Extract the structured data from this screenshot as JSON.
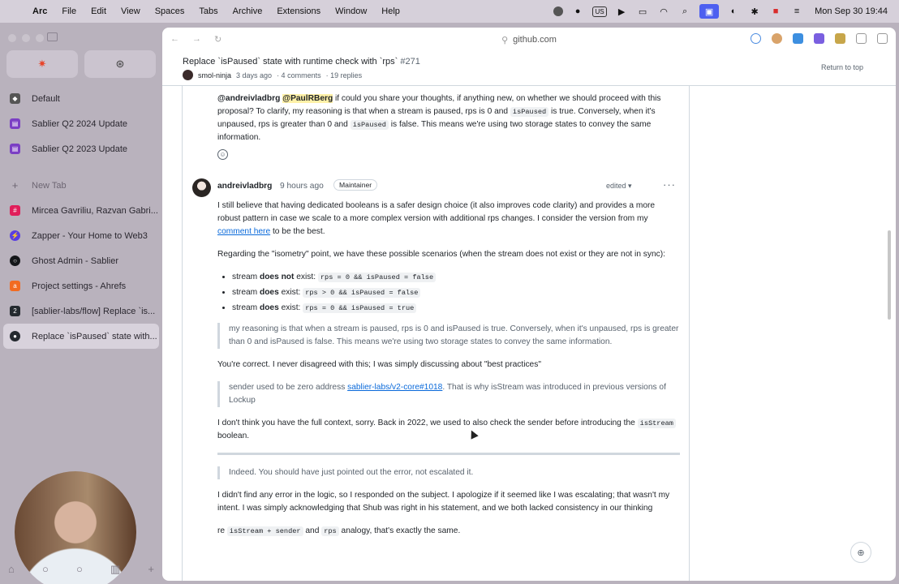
{
  "menubar": {
    "app": "Arc",
    "items": [
      "File",
      "Edit",
      "View",
      "Spaces",
      "Tabs",
      "Archive",
      "Extensions",
      "Window",
      "Help"
    ],
    "input_source": "US",
    "datetime": "Mon Sep 30  19:44"
  },
  "sidebar": {
    "items": [
      {
        "label": "Default",
        "icon": "tag-icon",
        "color": "#555555"
      },
      {
        "label": "Sablier Q2 2024 Update",
        "icon": "doc-icon",
        "color": "#7b3fc4"
      },
      {
        "label": "Sablier Q2 2023 Update",
        "icon": "doc-icon",
        "color": "#7b3fc4"
      }
    ],
    "new_tab": "New Tab",
    "tabs": [
      {
        "label": "Mircea Gavriliu, Razvan Gabri...",
        "icon": "slack-icon",
        "color": "#e01e5a"
      },
      {
        "label": "Zapper - Your Home to Web3",
        "icon": "zapper-icon",
        "color": "#5a3fe0"
      },
      {
        "label": "Ghost Admin - Sablier",
        "icon": "ghost-icon",
        "color": "#15171a"
      },
      {
        "label": "Project settings - Ahrefs",
        "icon": "ahrefs-icon",
        "color": "#f26b21"
      },
      {
        "label": "[sablier-labs/flow] Replace `is...",
        "icon": "github-icon",
        "color": "#24292f"
      },
      {
        "label": "Replace `isPaused` state with...",
        "icon": "github-icon",
        "color": "#24292f"
      }
    ]
  },
  "browser": {
    "url": "github.com"
  },
  "issue": {
    "title": "Replace `isPaused` state with runtime check with `rps`",
    "number": "#271",
    "author": "smol-ninja",
    "opened": "3 days ago",
    "comments": "· 4 comments",
    "replies": "· 19 replies",
    "return_to_top": "Return to top"
  },
  "comment1": {
    "mention1": "@andreivladbrg",
    "mention2": "@PaulRBerg",
    "t1": " if could you share your thoughts, if anything new, on whether we should proceed with this proposal? To clarify, my reasoning is that when a stream is paused, rps is 0 and ",
    "code1": "isPaused",
    "t2": " is true. Conversely, when it's unpaused, rps is greater than 0 and ",
    "code2": "isPaused",
    "t3": " is false. This means we're using two storage states to convey the same information."
  },
  "comment2": {
    "user": "andreivladbrg",
    "time": "9 hours ago",
    "badge": "Maintainer",
    "edited": "edited ▾",
    "p1a": "I still believe that having dedicated booleans is a safer design choice (it also improves code clarity) and provides a more robust pattern in case we scale to a more complex version with additional rps changes. I consider the version from my ",
    "p1link": "comment here",
    "p1b": " to be the best.",
    "p2": "Regarding the \"isometry\" point, we have these possible scenarios (when the stream does not exist or they are not in sync):",
    "bullets": [
      {
        "pre": "stream ",
        "bold": "does not",
        "post": " exist: ",
        "code": "rps = 0 && isPaused = false"
      },
      {
        "pre": "stream ",
        "bold": "does",
        "post": " exist: ",
        "code": "rps > 0 && isPaused = false"
      },
      {
        "pre": "stream ",
        "bold": "does",
        "post": " exist: ",
        "code": "rps = 0 && isPaused = true"
      }
    ],
    "quote1": "my reasoning is that when a stream is paused, rps is 0 and isPaused is true. Conversely, when it's unpaused, rps is greater than 0 and isPaused is false. This means we're using two storage states to convey the same information.",
    "p3": "You're correct. I never disagreed with this; I was simply discussing about \"best practices\"",
    "quote2a": "sender used to be zero address ",
    "quote2link": "sablier-labs/v2-core#1018",
    "quote2b": ". That is why isStream was introduced in previous versions of Lockup",
    "p4a": "I don't think you have the full context, sorry. Back in 2022, we used to also check the sender before introducing the ",
    "p4code": "isStream",
    "p4b": " boolean.",
    "quote3": "Indeed. You should have just pointed out the error, not escalated it.",
    "p5": "I didn't find any error in the logic, so I responded on the subject. I apologize if it seemed like I was escalating; that wasn't my intent. I was simply acknowledging that Shub was right in his statement, and we both lacked consistency in our thinking",
    "p6a": "re ",
    "p6code1": "isStream + sender",
    "p6b": " and ",
    "p6code2": "rps",
    "p6c": " analogy, that's exactly the same."
  }
}
